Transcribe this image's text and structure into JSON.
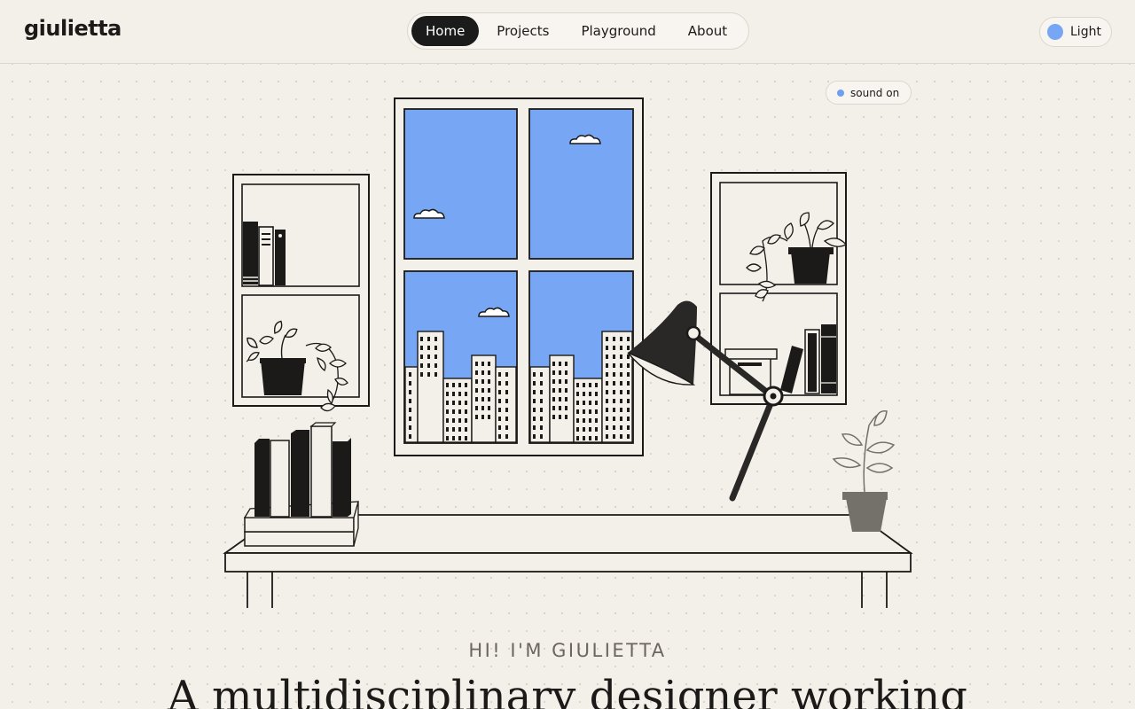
{
  "brand": {
    "logo_text": "giulietta"
  },
  "nav": {
    "tabs": [
      {
        "label": "Home",
        "active": true
      },
      {
        "label": "Projects",
        "active": false
      },
      {
        "label": "Playground",
        "active": false
      },
      {
        "label": "About",
        "active": false
      }
    ]
  },
  "theme_toggle": {
    "label": "Light",
    "dot_color": "#76a6f4"
  },
  "sound_toggle": {
    "label": "sound on",
    "dot_color": "#6f9ff0"
  },
  "hero": {
    "eyebrow": "HI! I'M GIULIETTA",
    "headline": "A multidisciplinary designer working"
  },
  "colors": {
    "background": "#f3efe9",
    "sky": "#76a6f4",
    "ink": "#1c1a18",
    "active_tab": "#1b1b1b"
  }
}
